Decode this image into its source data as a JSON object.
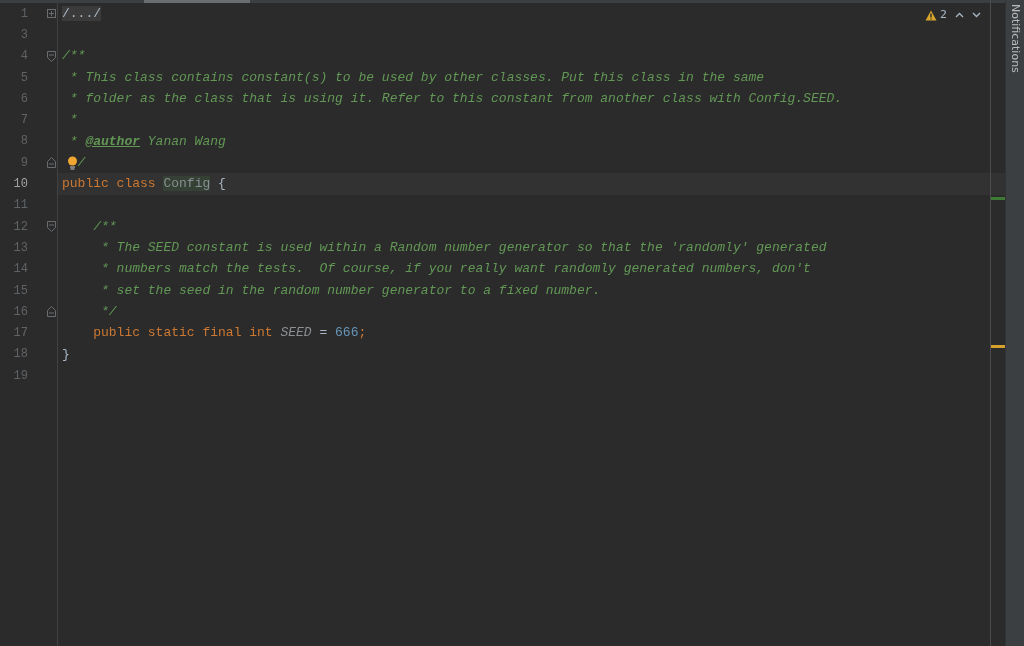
{
  "editor": {
    "lines": [
      {
        "number": "1",
        "current": false,
        "fold": {
          "kind": "expand"
        },
        "tokens": [
          {
            "kind": "folded",
            "text": "/.../"
          }
        ]
      },
      {
        "number": "3",
        "current": false
      },
      {
        "number": "4",
        "current": false,
        "fold": {
          "kind": "start"
        },
        "tokens": [
          {
            "kind": "doc",
            "text": "/**"
          }
        ]
      },
      {
        "number": "5",
        "current": false,
        "tokens": [
          {
            "kind": "doc",
            "text": " * This class contains constant(s) to be used by other classes. Put this class in the same"
          }
        ]
      },
      {
        "number": "6",
        "current": false,
        "tokens": [
          {
            "kind": "doc",
            "text": " * folder as the class that is using it. Refer to this constant from another class with Config.SEED."
          }
        ]
      },
      {
        "number": "7",
        "current": false,
        "tokens": [
          {
            "kind": "doc",
            "text": " *"
          }
        ]
      },
      {
        "number": "8",
        "current": false,
        "tokens": [
          {
            "kind": "doc",
            "text": " * "
          },
          {
            "kind": "tag",
            "text": "@author"
          },
          {
            "kind": "doc",
            "text": " Yanan Wang"
          }
        ]
      },
      {
        "number": "9",
        "current": false,
        "fold": {
          "kind": "end"
        },
        "lightbulb": true,
        "tokens": [
          {
            "kind": "doc",
            "text": "/"
          }
        ]
      },
      {
        "number": "10",
        "current": true,
        "tokens": [
          {
            "kind": "keyword",
            "text": "public class "
          },
          {
            "kind": "classname",
            "text": "Config"
          },
          {
            "kind": "plain",
            "text": " {"
          }
        ]
      },
      {
        "number": "11",
        "current": false
      },
      {
        "number": "12",
        "current": false,
        "fold": {
          "kind": "start"
        },
        "tokens": [
          {
            "kind": "doc",
            "text": "    /**"
          }
        ]
      },
      {
        "number": "13",
        "current": false,
        "tokens": [
          {
            "kind": "doc",
            "text": "     * The SEED constant is used within a Random number generator so that the 'randomly' generated"
          }
        ]
      },
      {
        "number": "14",
        "current": false,
        "tokens": [
          {
            "kind": "doc",
            "text": "     * numbers match the tests.  Of course, if you really want randomly generated numbers, don't"
          }
        ]
      },
      {
        "number": "15",
        "current": false,
        "tokens": [
          {
            "kind": "doc",
            "text": "     * set the seed in the random number generator to a fixed number."
          }
        ]
      },
      {
        "number": "16",
        "current": false,
        "fold": {
          "kind": "end"
        },
        "tokens": [
          {
            "kind": "doc",
            "text": "     */"
          }
        ]
      },
      {
        "number": "17",
        "current": false,
        "tokens": [
          {
            "kind": "keyword",
            "text": "    public static final int "
          },
          {
            "kind": "constant",
            "text": "SEED"
          },
          {
            "kind": "plain",
            "text": " = "
          },
          {
            "kind": "number",
            "text": "666"
          },
          {
            "kind": "keyword",
            "text": ";"
          }
        ]
      },
      {
        "number": "18",
        "current": false,
        "tokens": [
          {
            "kind": "plain",
            "text": "}"
          }
        ]
      },
      {
        "number": "19",
        "current": false
      }
    ],
    "inspections": {
      "warnings": "2"
    },
    "stripe_marks": [
      {
        "color": "#3d7a34"
      },
      {
        "color": "#d5a02b"
      }
    ]
  },
  "side_panel": {
    "label": "Notifications"
  }
}
